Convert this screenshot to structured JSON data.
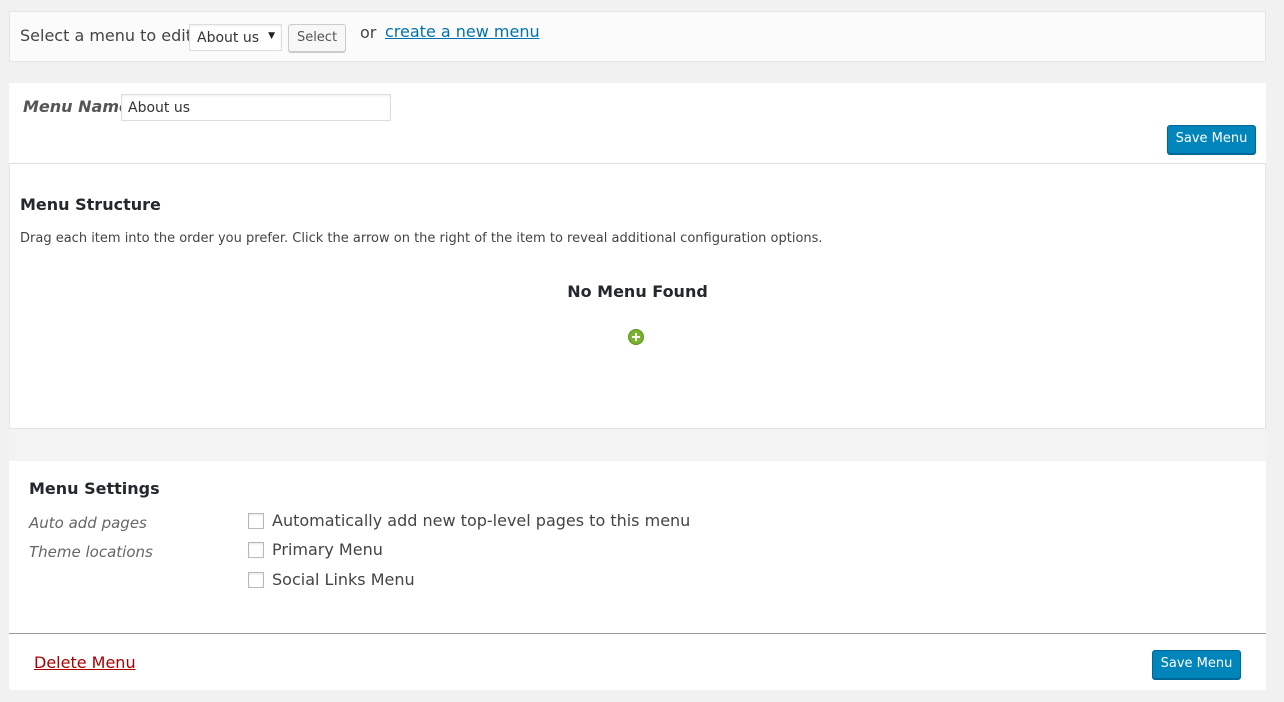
{
  "select_bar": {
    "label": "Select a menu to edit:",
    "selected_menu": "About us",
    "select_button": "Select",
    "or_text": "or",
    "create_link": "create a new menu"
  },
  "menu_header": {
    "name_label": "Menu Name",
    "name_value": "About us",
    "save_button": "Save Menu"
  },
  "structure": {
    "title": "Menu Structure",
    "description": "Drag each item into the order you prefer. Click the arrow on the right of the item to reveal additional configuration options.",
    "empty_message": "No Menu Found",
    "add_icon": "plus-circle-icon"
  },
  "settings": {
    "title": "Menu Settings",
    "auto_add_label": "Auto add pages",
    "theme_locations_label": "Theme locations",
    "options": [
      {
        "label": "Automatically add new top-level pages to this menu",
        "checked": false
      },
      {
        "label": "Primary Menu",
        "checked": false
      },
      {
        "label": "Social Links Menu",
        "checked": false
      }
    ]
  },
  "footer": {
    "delete_link": "Delete Menu",
    "save_button": "Save Menu"
  },
  "colors": {
    "primary_button": "#0085ba",
    "link": "#0073aa",
    "delete_link": "#aa0000",
    "add_icon": "#7ab32e"
  }
}
